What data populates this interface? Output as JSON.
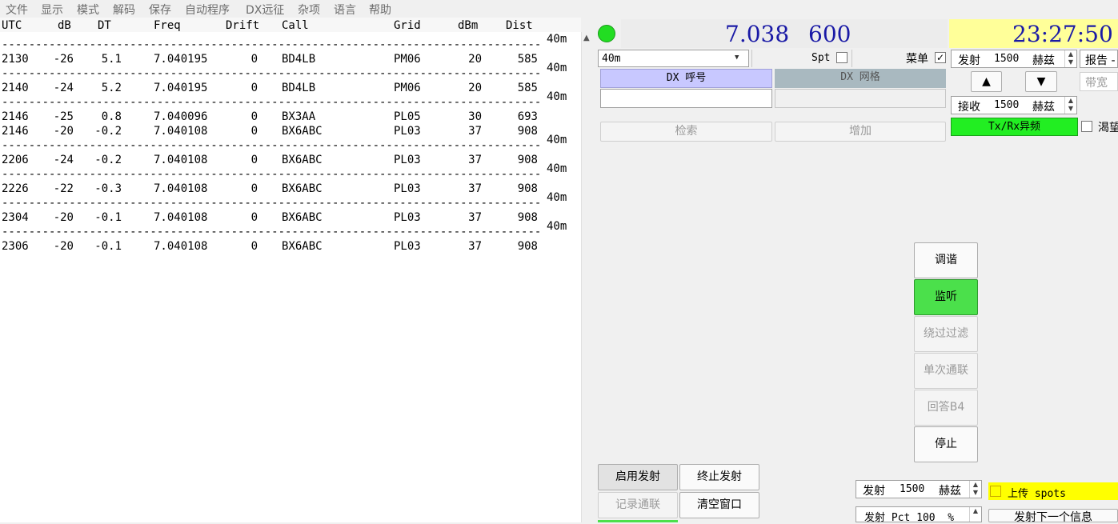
{
  "menu": [
    "文件",
    "显示",
    "模式",
    "解码",
    "保存",
    "自动程序",
    "DX远征",
    "杂项",
    "语言",
    "帮助"
  ],
  "decode": {
    "headers": {
      "utc": "UTC",
      "db": "dB",
      "dt": "DT",
      "freq": "Freq",
      "drift": "Drift",
      "call": "Call",
      "grid": "Grid",
      "dbm": "dBm",
      "dist": "Dist"
    },
    "band_label": "40m",
    "rows": [
      {
        "utc": "2130",
        "db": "-26",
        "dt": "5.1",
        "freq": "7.040195",
        "drift": "0",
        "call": "BD4LB",
        "grid": "PM06",
        "dbm": "20",
        "dist": "585"
      },
      {
        "utc": "2140",
        "db": "-24",
        "dt": "5.2",
        "freq": "7.040195",
        "drift": "0",
        "call": "BD4LB",
        "grid": "PM06",
        "dbm": "20",
        "dist": "585"
      },
      {
        "utc": "2146",
        "db": "-25",
        "dt": "0.8",
        "freq": "7.040096",
        "drift": "0",
        "call": "BX3AA",
        "grid": "PL05",
        "dbm": "30",
        "dist": "693"
      },
      {
        "utc": "2146",
        "db": "-20",
        "dt": "-0.2",
        "freq": "7.040108",
        "drift": "0",
        "call": "BX6ABC",
        "grid": "PL03",
        "dbm": "37",
        "dist": "908"
      },
      {
        "utc": "2206",
        "db": "-24",
        "dt": "-0.2",
        "freq": "7.040108",
        "drift": "0",
        "call": "BX6ABC",
        "grid": "PL03",
        "dbm": "37",
        "dist": "908"
      },
      {
        "utc": "2226",
        "db": "-22",
        "dt": "-0.3",
        "freq": "7.040108",
        "drift": "0",
        "call": "BX6ABC",
        "grid": "PL03",
        "dbm": "37",
        "dist": "908"
      },
      {
        "utc": "2304",
        "db": "-20",
        "dt": "-0.1",
        "freq": "7.040108",
        "drift": "0",
        "call": "BX6ABC",
        "grid": "PL03",
        "dbm": "37",
        "dist": "908"
      },
      {
        "utc": "2306",
        "db": "-20",
        "dt": "-0.1",
        "freq": "7.040108",
        "drift": "0",
        "call": "BX6ABC",
        "grid": "PL03",
        "dbm": "37",
        "dist": "908"
      }
    ]
  },
  "radio": {
    "dial_freq": "7.038",
    "offset": "600",
    "clock": "23:27:50",
    "band_select": "40m",
    "spt_label": "Spt",
    "menu_label": "菜单",
    "menu_checked": "✓",
    "tx_label": "发射",
    "tx_freq": "1500",
    "hz": "赫兹",
    "rx_label": "接收",
    "rx_freq": "1500",
    "report_label": "报告 -",
    "bandwidth_label": "带宽",
    "txrx_split": "Tx/Rx异频",
    "wish_label": "渴望"
  },
  "dx": {
    "call_header": "DX 呼号",
    "grid_header": "DX 网格",
    "search_btn": "检索",
    "add_btn": "增加"
  },
  "actions": {
    "tune": "调谐",
    "monitor": "监听",
    "bypass_filter": "绕过过滤",
    "single_qso": "单次通联",
    "reply_b4": "回答B4",
    "stop": "停止",
    "enable_tx": "启用发射",
    "halt_tx": "终止发射",
    "log_qso": "记录通联",
    "clear_window": "清空窗口"
  },
  "bottom": {
    "tx_label": "发射",
    "tx_freq": "1500",
    "hz": "赫兹",
    "upload_spots": "上传 spots",
    "tx_pct": "发射 Pct 100  %",
    "tx_next": "发射下一个信息"
  },
  "colors": {
    "accent_blue": "#1a1aa6",
    "clock_bg": "#ffff99",
    "green": "#4be04b",
    "yellow": "#ffff00",
    "dx_call_bg": "#c8c8ff",
    "dx_grid_bg": "#a9b9c0"
  }
}
